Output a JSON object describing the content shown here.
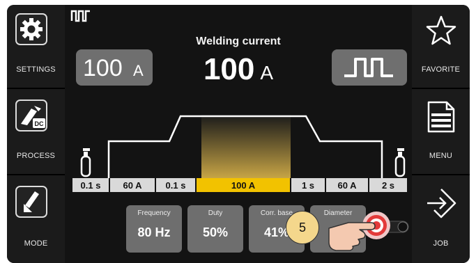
{
  "left_sidebar": {
    "settings_label": "SETTINGS",
    "process_label": "PROCESS",
    "process_badge": "DC",
    "mode_label": "MODE"
  },
  "right_sidebar": {
    "favorite_label": "FAVORITE",
    "menu_label": "MENU",
    "job_label": "JOB"
  },
  "header": {
    "title": "Welding current",
    "main_value": "100",
    "main_unit": "A"
  },
  "left_pill": {
    "value": "100",
    "unit": "A"
  },
  "sequence": [
    {
      "label": "0.1 s",
      "active": false
    },
    {
      "label": "60 A",
      "active": false
    },
    {
      "label": "0.1 s",
      "active": false
    },
    {
      "label": "100 A",
      "active": true
    },
    {
      "label": "1 s",
      "active": false
    },
    {
      "label": "60 A",
      "active": false
    },
    {
      "label": "2 s",
      "active": false
    }
  ],
  "params": [
    {
      "title": "Frequency",
      "value": "80 Hz"
    },
    {
      "title": "Duty",
      "value": "50%"
    },
    {
      "title": "Corr. base",
      "value": "41%"
    },
    {
      "title": "Diameter",
      "value": ""
    }
  ],
  "callout": "5",
  "colors": {
    "active_segment": "#f2c200",
    "pill": "#6f6f6f",
    "touch_target": "#e33a3a"
  }
}
